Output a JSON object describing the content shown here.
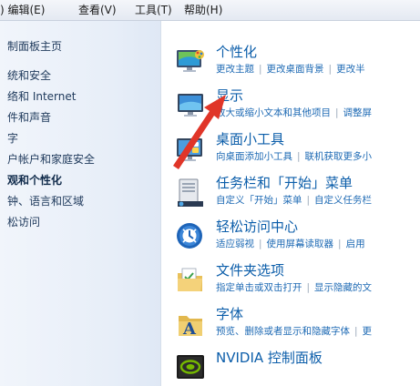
{
  "menubar": {
    "items": [
      ") 编辑(E)",
      "查看(V)",
      "工具(T)",
      "帮助(H)"
    ]
  },
  "nav": {
    "items": [
      "制面板主页",
      "统和安全",
      "络和 Internet",
      "件和声音",
      "字",
      "户帐户和家庭安全",
      "观和个性化",
      "钟、语言和区域",
      "松访问"
    ],
    "active_index": 6
  },
  "categories": [
    {
      "title": "个性化",
      "icon": "personalization-icon",
      "links": [
        "更改主题",
        "更改桌面背景",
        "更改半"
      ]
    },
    {
      "title": "显示",
      "icon": "display-icon",
      "links": [
        "放大或缩小文本和其他项目",
        "调整屏"
      ]
    },
    {
      "title": "桌面小工具",
      "icon": "gadgets-icon",
      "links": [
        "向桌面添加小工具",
        "联机获取更多小"
      ]
    },
    {
      "title": "任务栏和「开始」菜单",
      "icon": "taskbar-icon",
      "links": [
        "自定义「开始」菜单",
        "自定义任务栏"
      ]
    },
    {
      "title": "轻松访问中心",
      "icon": "ease-of-access-icon",
      "links": [
        "适应弱视",
        "使用屏幕读取器",
        "启用"
      ]
    },
    {
      "title": "文件夹选项",
      "icon": "folder-options-icon",
      "links": [
        "指定单击或双击打开",
        "显示隐藏的文"
      ]
    },
    {
      "title": "字体",
      "icon": "fonts-icon",
      "links": [
        "预览、删除或者显示和隐藏字体",
        "更"
      ]
    },
    {
      "title": "NVIDIA 控制面板",
      "icon": "nvidia-icon",
      "links": []
    }
  ],
  "colors": {
    "link": "#1e6ab4",
    "title": "#0c5eaa",
    "arrow": "#e03528"
  }
}
